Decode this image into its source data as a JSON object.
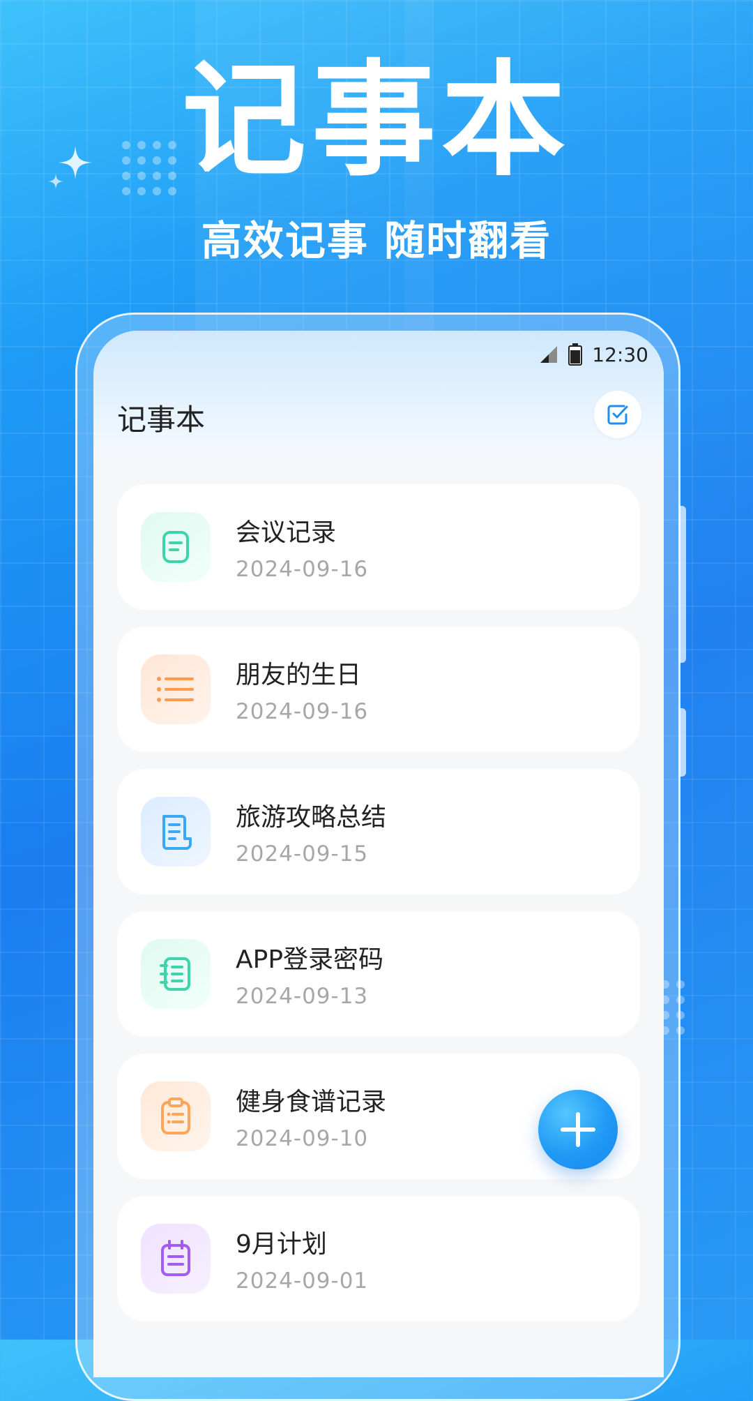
{
  "hero": {
    "title": "记事本",
    "subtitle": "高效记事 随时翻看"
  },
  "status_bar": {
    "time": "12:30"
  },
  "app": {
    "title": "记事本"
  },
  "notes": [
    {
      "title": "会议记录",
      "date": "2024-09-16",
      "icon": "note-icon",
      "color": "#3ed3a8"
    },
    {
      "title": "朋友的生日",
      "date": "2024-09-16",
      "icon": "list-icon",
      "color": "#ff9a4d"
    },
    {
      "title": "旅游攻略总结",
      "date": "2024-09-15",
      "icon": "document-icon",
      "color": "#3ba8f4"
    },
    {
      "title": "APP登录密码",
      "date": "2024-09-13",
      "icon": "notebook-icon",
      "color": "#3ed3a8"
    },
    {
      "title": "健身食谱记录",
      "date": "2024-09-10",
      "icon": "clipboard-icon",
      "color": "#ffa55a"
    },
    {
      "title": "9月计划",
      "date": "2024-09-01",
      "icon": "calendar-icon",
      "color": "#a15cf0"
    }
  ]
}
